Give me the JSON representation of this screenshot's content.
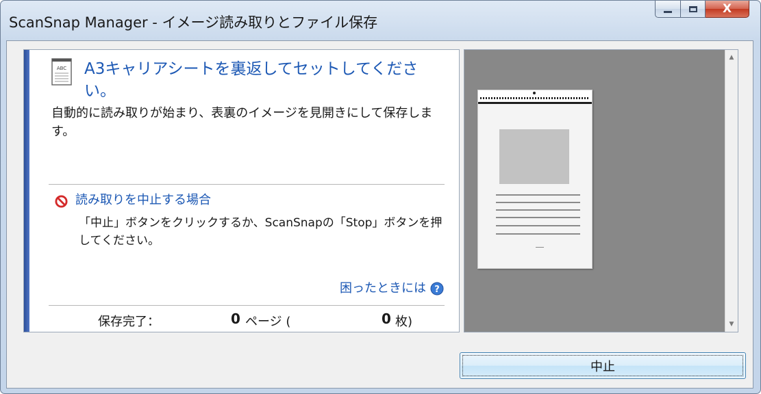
{
  "window": {
    "title": "ScanSnap Manager - イメージ読み取りとファイル保存",
    "close_label": "X"
  },
  "message": {
    "main": "A3キャリアシートを裏返してセットしてください。",
    "sub": "自動的に読み取りが始まり、表裏のイメージを見開きにして保存します。",
    "icon_text": "ABC"
  },
  "cancel_info": {
    "title": "読み取りを中止する場合",
    "description": "「中止」ボタンをクリックするか、ScanSnapの「Stop」ボタンを押してください。"
  },
  "help": {
    "label": "困ったときには"
  },
  "status": {
    "label": "保存完了：",
    "pages_count": "0",
    "pages_unit": "ページ (",
    "sheets_count": "0",
    "sheets_unit": "枚)"
  },
  "buttons": {
    "stop": "中止"
  },
  "colors": {
    "accent": "#2c4f9a",
    "link_text": "#1c58b4",
    "preview_bg": "#888888"
  },
  "icons": {
    "document": "document-abc-icon",
    "cancel": "no-entry-icon",
    "help": "question-icon"
  }
}
